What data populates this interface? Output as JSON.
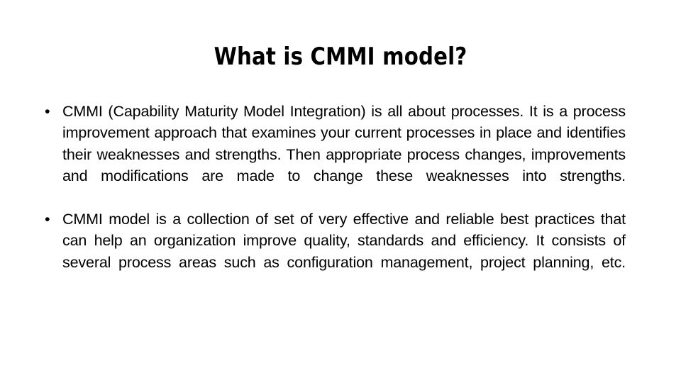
{
  "slide": {
    "title": "What is CMMI model?",
    "background_color": "#ffffff",
    "text_color": "#000000",
    "bullet_glyph": "•",
    "bullets": [
      {
        "text": "CMMI (Capability Maturity Model Integration) is all about processes. It is a process improvement approach that examines your current processes in place and identifies their weaknesses and strengths. Then appropriate process changes, improvements and modifications are made to change these weaknesses into strengths."
      },
      {
        "text": "CMMI model is a collection of set of very effective and reliable best practices that can help an organization improve quality, standards and efficiency. It consists of several process areas such as configuration management, project planning, etc."
      }
    ]
  }
}
